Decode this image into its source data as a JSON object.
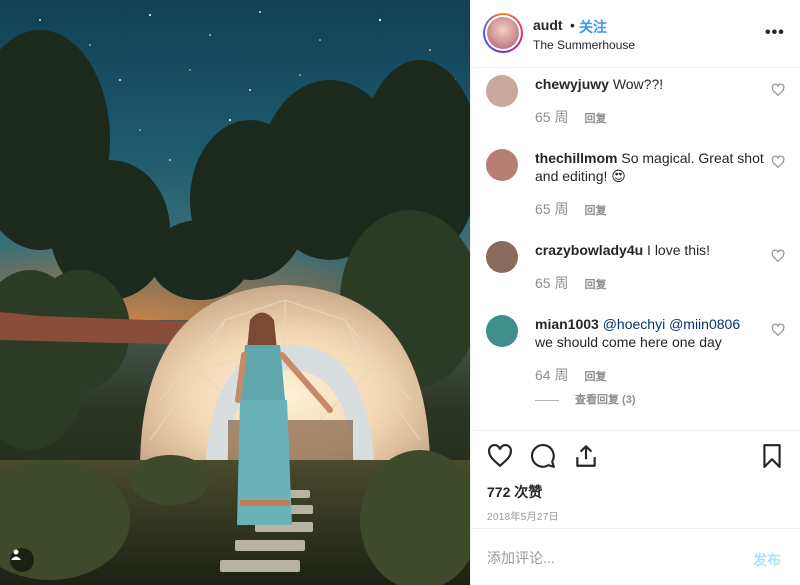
{
  "post": {
    "image_alt": "Woman in a garden in front of a glowing geodesic dome under a starry night sky"
  },
  "header": {
    "username": "audt",
    "separator": "•",
    "follow_label": "关注",
    "location": "The Summerhouse",
    "more_label": "•••"
  },
  "comments": [
    {
      "user": "chewyjuwy",
      "text": "Wow??!",
      "mention": "",
      "time": "65 周",
      "reply_label": "回复",
      "avatar_color": "#c9a79a"
    },
    {
      "user": "thechillmom",
      "text": "So magical. Great shot and editing! 😍",
      "mention": "",
      "time": "65 周",
      "reply_label": "回复",
      "avatar_color": "#b57f74"
    },
    {
      "user": "crazybowlady4u",
      "text": "I love this!",
      "mention": "",
      "time": "65 周",
      "reply_label": "回复",
      "avatar_color": "#8a6a5c"
    },
    {
      "user": "mian1003",
      "text": "we should come here one day",
      "mention": "@hoechyi @miin0806",
      "time": "64 周",
      "reply_label": "回复",
      "avatar_color": "#3f8f8a"
    }
  ],
  "view_replies_label": "查看回复 (3)",
  "likes_label": "772 次赞",
  "date_label": "2018年5月27日",
  "add_comment": {
    "placeholder": "添加评论...",
    "post_label": "发布"
  },
  "colors": {
    "link_blue": "#3897f0",
    "mention_blue": "#003569",
    "muted": "#8e8e8e",
    "post_disabled": "#b2dffc"
  }
}
